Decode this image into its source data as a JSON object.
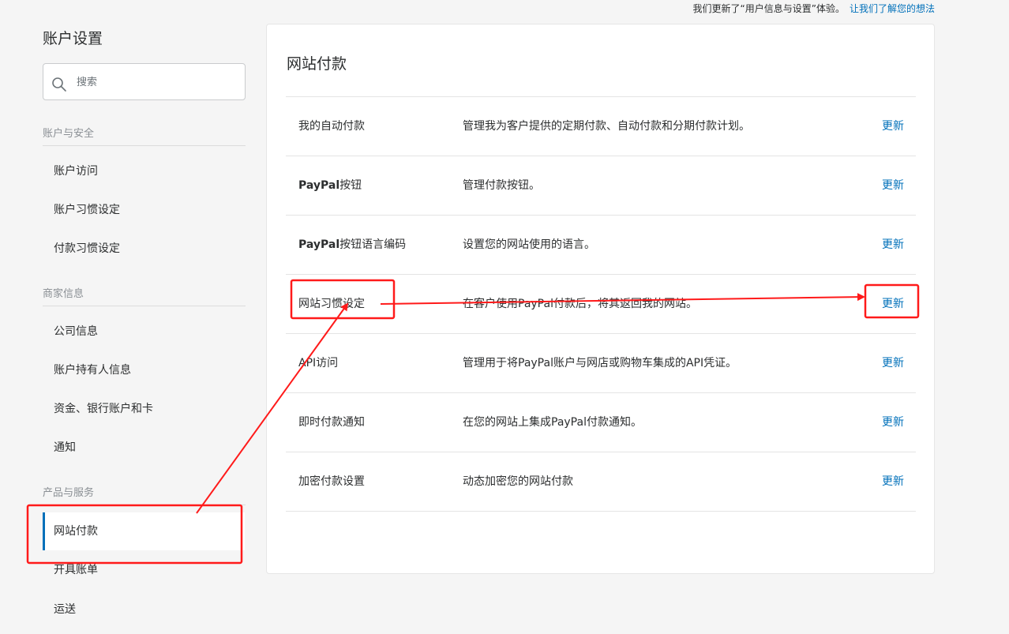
{
  "topbar": {
    "notice": "我们更新了“用户信息与设置”体验。",
    "feedback_link": "让我们了解您的想法"
  },
  "sidebar": {
    "title": "账户设置",
    "search_placeholder": "搜索",
    "sections": [
      {
        "title": "账户与安全",
        "items": [
          "账户访问",
          "账户习惯设定",
          "付款习惯设定"
        ]
      },
      {
        "title": "商家信息",
        "items": [
          "公司信息",
          "账户持有人信息",
          "资金、银行账户和卡",
          "通知"
        ]
      },
      {
        "title": "产品与服务",
        "items": [
          "网站付款",
          "开具账单",
          "运送"
        ]
      }
    ],
    "active_item": "网站付款"
  },
  "main": {
    "title": "网站付款",
    "rows": [
      {
        "name_bold": "",
        "name": "我的自动付款",
        "desc": "管理我为客户提供的定期付款、自动付款和分期付款计划。",
        "action": "更新"
      },
      {
        "name_bold": "PayPal",
        "name": "按钮",
        "desc": "管理付款按钮。",
        "action": "更新"
      },
      {
        "name_bold": "PayPal",
        "name": "按钮语言编码",
        "desc": "设置您的网站使用的语言。",
        "action": "更新"
      },
      {
        "name_bold": "",
        "name": "网站习惯设定",
        "desc": "在客户使用PayPal付款后，将其返回我的网站。",
        "action": "更新"
      },
      {
        "name_bold": "",
        "name": "API访问",
        "desc": "管理用于将PayPal账户与网店或购物车集成的API凭证。",
        "action": "更新"
      },
      {
        "name_bold": "",
        "name": "即时付款通知",
        "desc": "在您的网站上集成PayPal付款通知。",
        "action": "更新"
      },
      {
        "name_bold": "",
        "name": "加密付款设置",
        "desc": "动态加密您的网站付款",
        "action": "更新"
      }
    ]
  },
  "colors": {
    "link": "#0070ba",
    "annotation": "#ff1a1a"
  }
}
